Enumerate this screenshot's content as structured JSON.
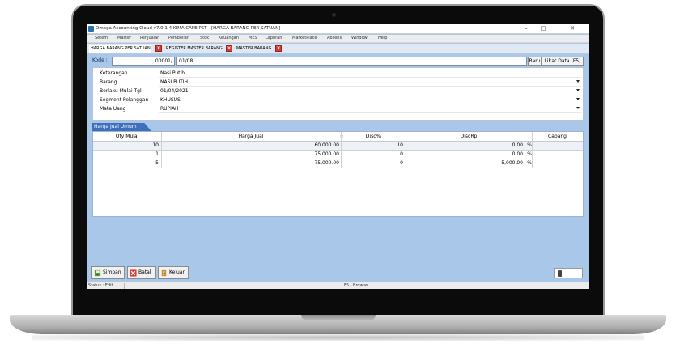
{
  "window": {
    "title": "Omega Accounting Cloud v7.0.1.4 KIMA CAFE PST - [HARGA BARANG PER SATUAN]",
    "minimize": "–",
    "maximize": "□",
    "close": "✕"
  },
  "menu": [
    "Setem",
    "Master",
    "Penjualan",
    "Pembelian",
    "Stok",
    "Keuangan",
    "MES",
    "Laporan",
    "MarketPlace",
    "Absensi",
    "Window",
    "Help"
  ],
  "tabs": [
    {
      "label": "HARGA BARANG PER SATUAN",
      "active": true
    },
    {
      "label": "REGISTER MASTER BARANG",
      "active": false
    },
    {
      "label": "MASTER BARANG",
      "active": false
    }
  ],
  "kode": {
    "label": "Kode :",
    "prefix": "00001/",
    "value": "01/08",
    "baru_label": "Baru",
    "lihat_label": "Lihat Data (F5)"
  },
  "form": {
    "keterangan": {
      "label": "Keterangan",
      "value": "Nasi Putih"
    },
    "barang": {
      "label": "Barang",
      "value": "NASI PUTIH"
    },
    "berlaku": {
      "label": "Berlaku Mulai Tgl",
      "value": "01/04/2021"
    },
    "segment": {
      "label": "Segment Pelanggan",
      "value": "KHUSUS"
    },
    "mata_uang": {
      "label": "Mata Uang",
      "value": "RUPIAH"
    }
  },
  "grid": {
    "group_label": "Harga Jual Umum",
    "columns": [
      "Qty Mulai",
      "Harga Jual",
      "Disc%",
      "DiscRp",
      "Cabang"
    ],
    "rows": [
      {
        "qty": "10",
        "harga": "60,000.00",
        "disc_pct": "10",
        "disc_rp": "0.00",
        "unit": "%"
      },
      {
        "qty": "1",
        "harga": "75,000.00",
        "disc_pct": "0",
        "disc_rp": "0.00",
        "unit": "%"
      },
      {
        "qty": "5",
        "harga": "75,000.00",
        "disc_pct": "0",
        "disc_rp": "5,000.00",
        "unit": "%"
      }
    ]
  },
  "actions": {
    "simpan": "Simpan",
    "batal": "Batal",
    "keluar": "Keluar"
  },
  "status": {
    "left": "Status : Edit",
    "middle": "F5 - Browse"
  }
}
